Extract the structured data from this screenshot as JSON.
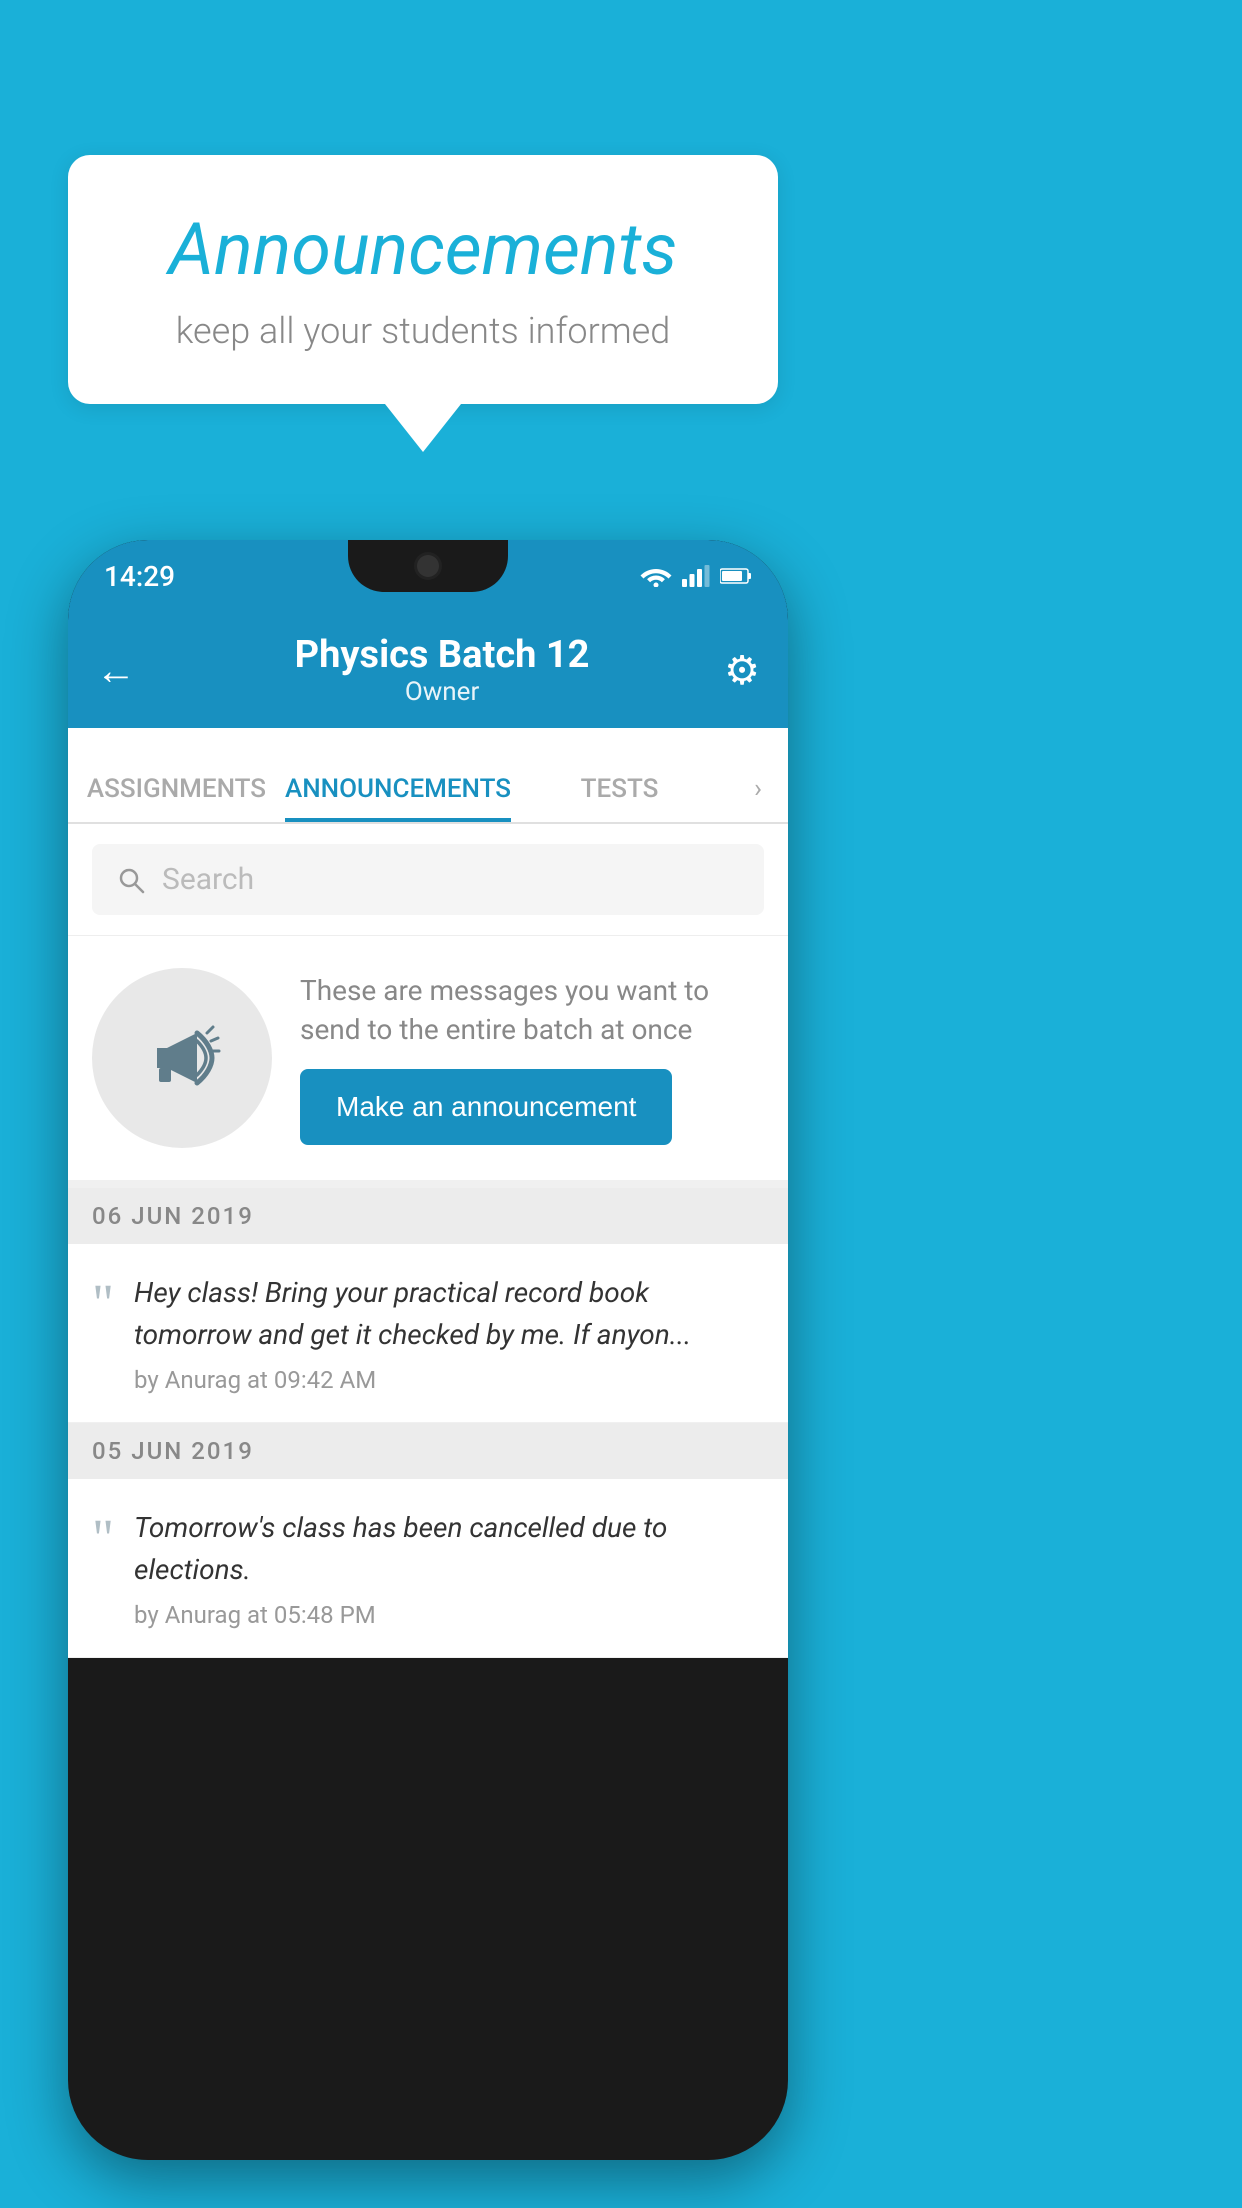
{
  "background_color": "#1ab0d8",
  "speech_bubble": {
    "title": "Announcements",
    "subtitle": "keep all your students informed"
  },
  "status_bar": {
    "time": "14:29",
    "wifi_icon": "wifi",
    "signal_icon": "signal",
    "battery_icon": "battery"
  },
  "header": {
    "title": "Physics Batch 12",
    "subtitle": "Owner",
    "back_label": "←",
    "settings_label": "⚙"
  },
  "tabs": [
    {
      "label": "ASSIGNMENTS",
      "active": false
    },
    {
      "label": "ANNOUNCEMENTS",
      "active": true
    },
    {
      "label": "TESTS",
      "active": false
    }
  ],
  "search": {
    "placeholder": "Search"
  },
  "announcement_prompt": {
    "description": "These are messages you want to send to the entire batch at once",
    "button_label": "Make an announcement"
  },
  "date_separators": [
    {
      "label": "06  JUN  2019"
    },
    {
      "label": "05  JUN  2019"
    }
  ],
  "announcements": [
    {
      "text": "Hey class! Bring your practical record book tomorrow and get it checked by me. If anyon...",
      "meta": "by Anurag at 09:42 AM"
    },
    {
      "text": "Tomorrow's class has been cancelled due to elections.",
      "meta": "by Anurag at 05:48 PM"
    }
  ]
}
